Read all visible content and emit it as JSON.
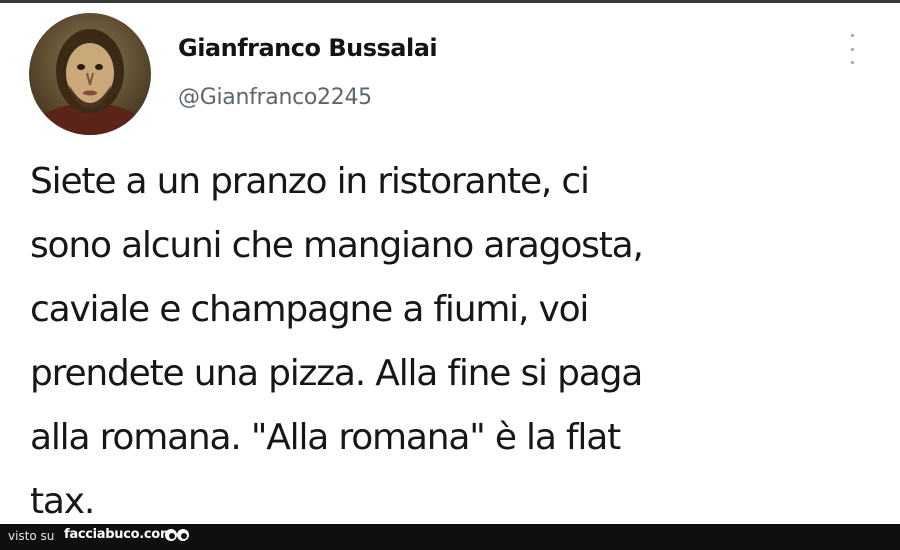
{
  "tweet": {
    "display_name": "Gianfranco Bussalai",
    "handle": "@Gianfranco2245",
    "text": "Siete a un pranzo in ristorante, ci\nsono alcuni che mangiano aragosta,\ncaviale e champagne a fiumi, voi\nprendete una pizza. Alla fine si paga\nalla romana. \"Alla romana\" è la flat\ntax.",
    "avatar_icon": "painted-face-avatar",
    "more_icon": "vertical-dots-icon"
  },
  "footer": {
    "visto_su": "visto su",
    "site": "facciabuco.com",
    "logo_icon": "eyes-logo-icon",
    "background": "#0f0f0f"
  }
}
